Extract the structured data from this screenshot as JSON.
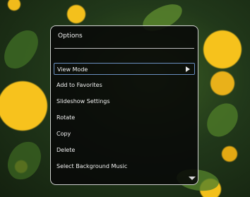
{
  "menu": {
    "title": "Options",
    "items": [
      {
        "label": "View Mode",
        "selected": true,
        "has_submenu": true
      },
      {
        "label": "Add to Favorites"
      },
      {
        "label": "Slideshow Settings"
      },
      {
        "label": "Rotate"
      },
      {
        "label": "Copy"
      },
      {
        "label": "Delete"
      },
      {
        "label": "Select Background Music"
      }
    ],
    "more_indicator": "scroll-down-icon"
  },
  "colors": {
    "menu_bg": "#080808",
    "menu_border": "#cfcfcf",
    "selection_border": "#6a8fc0",
    "text": "#f2f2f2"
  }
}
